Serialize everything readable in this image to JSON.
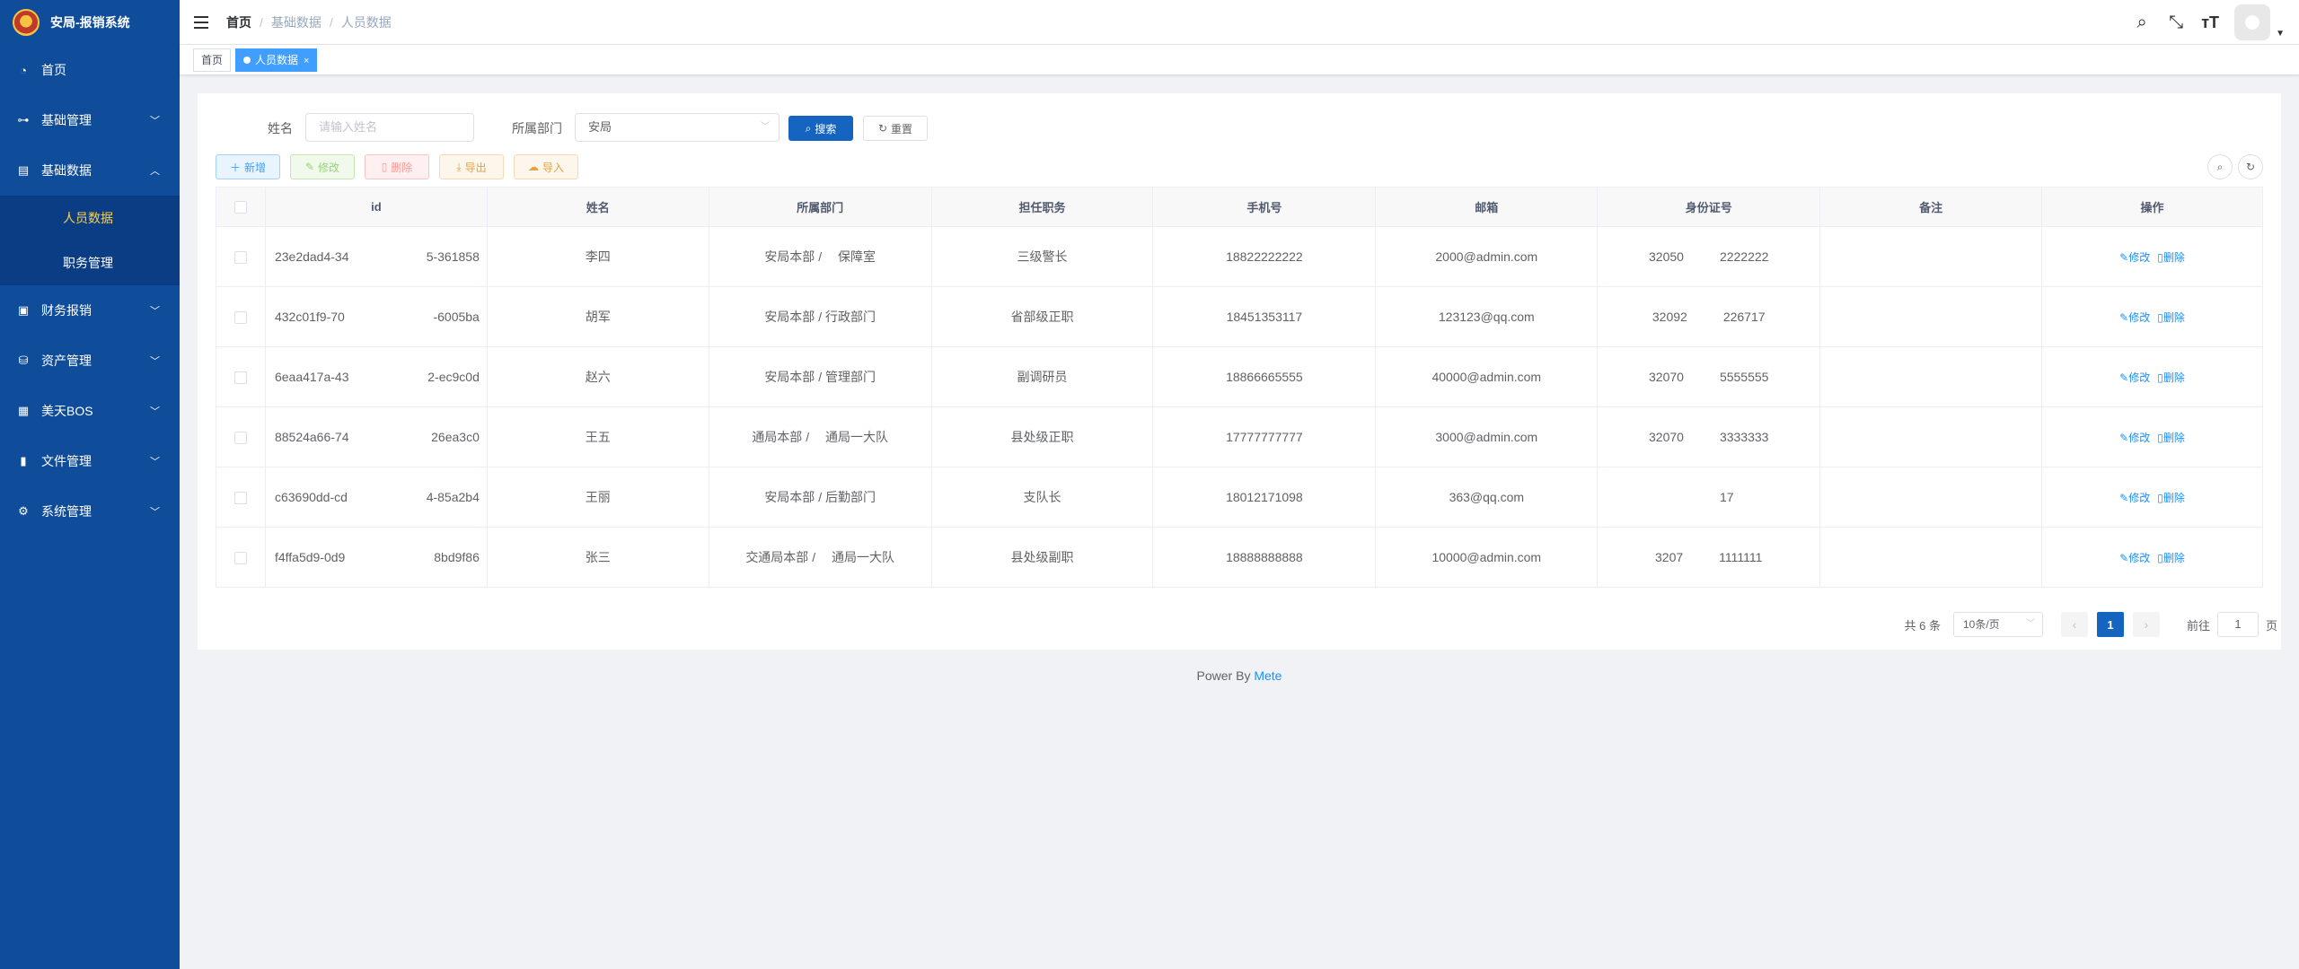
{
  "app": {
    "title": "安局-报销系统"
  },
  "sidebar": {
    "items": [
      {
        "label": "首页",
        "icon": "dashboard-icon"
      },
      {
        "label": "基础管理",
        "icon": "tree-icon"
      },
      {
        "label": "基础数据",
        "icon": "list-icon"
      },
      {
        "label": "财务报销",
        "icon": "finance-icon"
      },
      {
        "label": "资产管理",
        "icon": "asset-icon"
      },
      {
        "label": "美天BOS",
        "icon": "grid-icon"
      },
      {
        "label": "文件管理",
        "icon": "file-icon"
      },
      {
        "label": "系统管理",
        "icon": "gear-icon"
      }
    ],
    "submenu": [
      {
        "label": "人员数据"
      },
      {
        "label": "职务管理"
      }
    ]
  },
  "header": {
    "breadcrumb": [
      "首页",
      "基础数据",
      "人员数据"
    ],
    "separator": "/"
  },
  "tags": [
    {
      "label": "首页"
    },
    {
      "label": "人员数据",
      "close": "×"
    }
  ],
  "search": {
    "name_label": "姓名",
    "name_placeholder": "请输入姓名",
    "dept_label": "所属部门",
    "dept_value": "安局",
    "search_btn": "搜索",
    "reset_btn": "重置"
  },
  "toolbar": {
    "add": "新增",
    "edit": "修改",
    "delete": "删除",
    "export": "导出",
    "import": "导入"
  },
  "table": {
    "headers": [
      "id",
      "姓名",
      "所属部门",
      "担任职务",
      "手机号",
      "邮箱",
      "身份证号",
      "备注",
      "操作"
    ],
    "rows": [
      {
        "id_a": "23e2dad4-34",
        "id_b": "5-361858",
        "name": "李四",
        "dept": "安局本部 / 　保障室",
        "post": "三级警长",
        "phone": "18822222222",
        "email": "2000@admin.com",
        "idcard_a": "32050",
        "idcard_b": "2222222",
        "remark": ""
      },
      {
        "id_a": "432c01f9-70",
        "id_b": "-6005ba",
        "name": "胡军",
        "dept": "安局本部 / 行政部门",
        "post": "省部级正职",
        "phone": "18451353117",
        "email": "123123@qq.com",
        "idcard_a": "32092",
        "idcard_b": "226717",
        "remark": ""
      },
      {
        "id_a": "6eaa417a-43",
        "id_b": "2-ec9c0d",
        "name": "赵六",
        "dept": "安局本部 / 管理部门",
        "post": "副调研员",
        "phone": "18866665555",
        "email": "40000@admin.com",
        "idcard_a": "32070",
        "idcard_b": "5555555",
        "remark": ""
      },
      {
        "id_a": "88524a66-74",
        "id_b": "26ea3c0",
        "name": "王五",
        "dept": "通局本部 / 　通局一大队",
        "post": "县处级正职",
        "phone": "17777777777",
        "email": "3000@admin.com",
        "idcard_a": "32070",
        "idcard_b": "3333333",
        "remark": ""
      },
      {
        "id_a": "c63690dd-cd",
        "id_b": "4-85a2b4",
        "name": "王丽",
        "dept": "安局本部 / 后勤部门",
        "post": "支队长",
        "phone": "18012171098",
        "email": "363@qq.com",
        "idcard_a": "",
        "idcard_b": "17",
        "remark": ""
      },
      {
        "id_a": "f4ffa5d9-0d9",
        "id_b": "8bd9f86",
        "name": "张三",
        "dept": "交通局本部 / 　通局一大队",
        "post": "县处级副职",
        "phone": "18888888888",
        "email": "10000@admin.com",
        "idcard_a": "3207",
        "idcard_b": "1111111",
        "remark": ""
      }
    ],
    "op_edit": "修改",
    "op_delete": "删除"
  },
  "pagination": {
    "total": "共 6 条",
    "page_size": "10条/页",
    "current": "1",
    "goto_label": "前往",
    "goto_value": "1",
    "page_suffix": "页"
  },
  "footer": {
    "prefix": "Power By ",
    "link": "Mete"
  },
  "colors": {
    "sidebar": "#0f4c9a",
    "primary": "#1565c0",
    "active_menu": "#ffd04b"
  }
}
